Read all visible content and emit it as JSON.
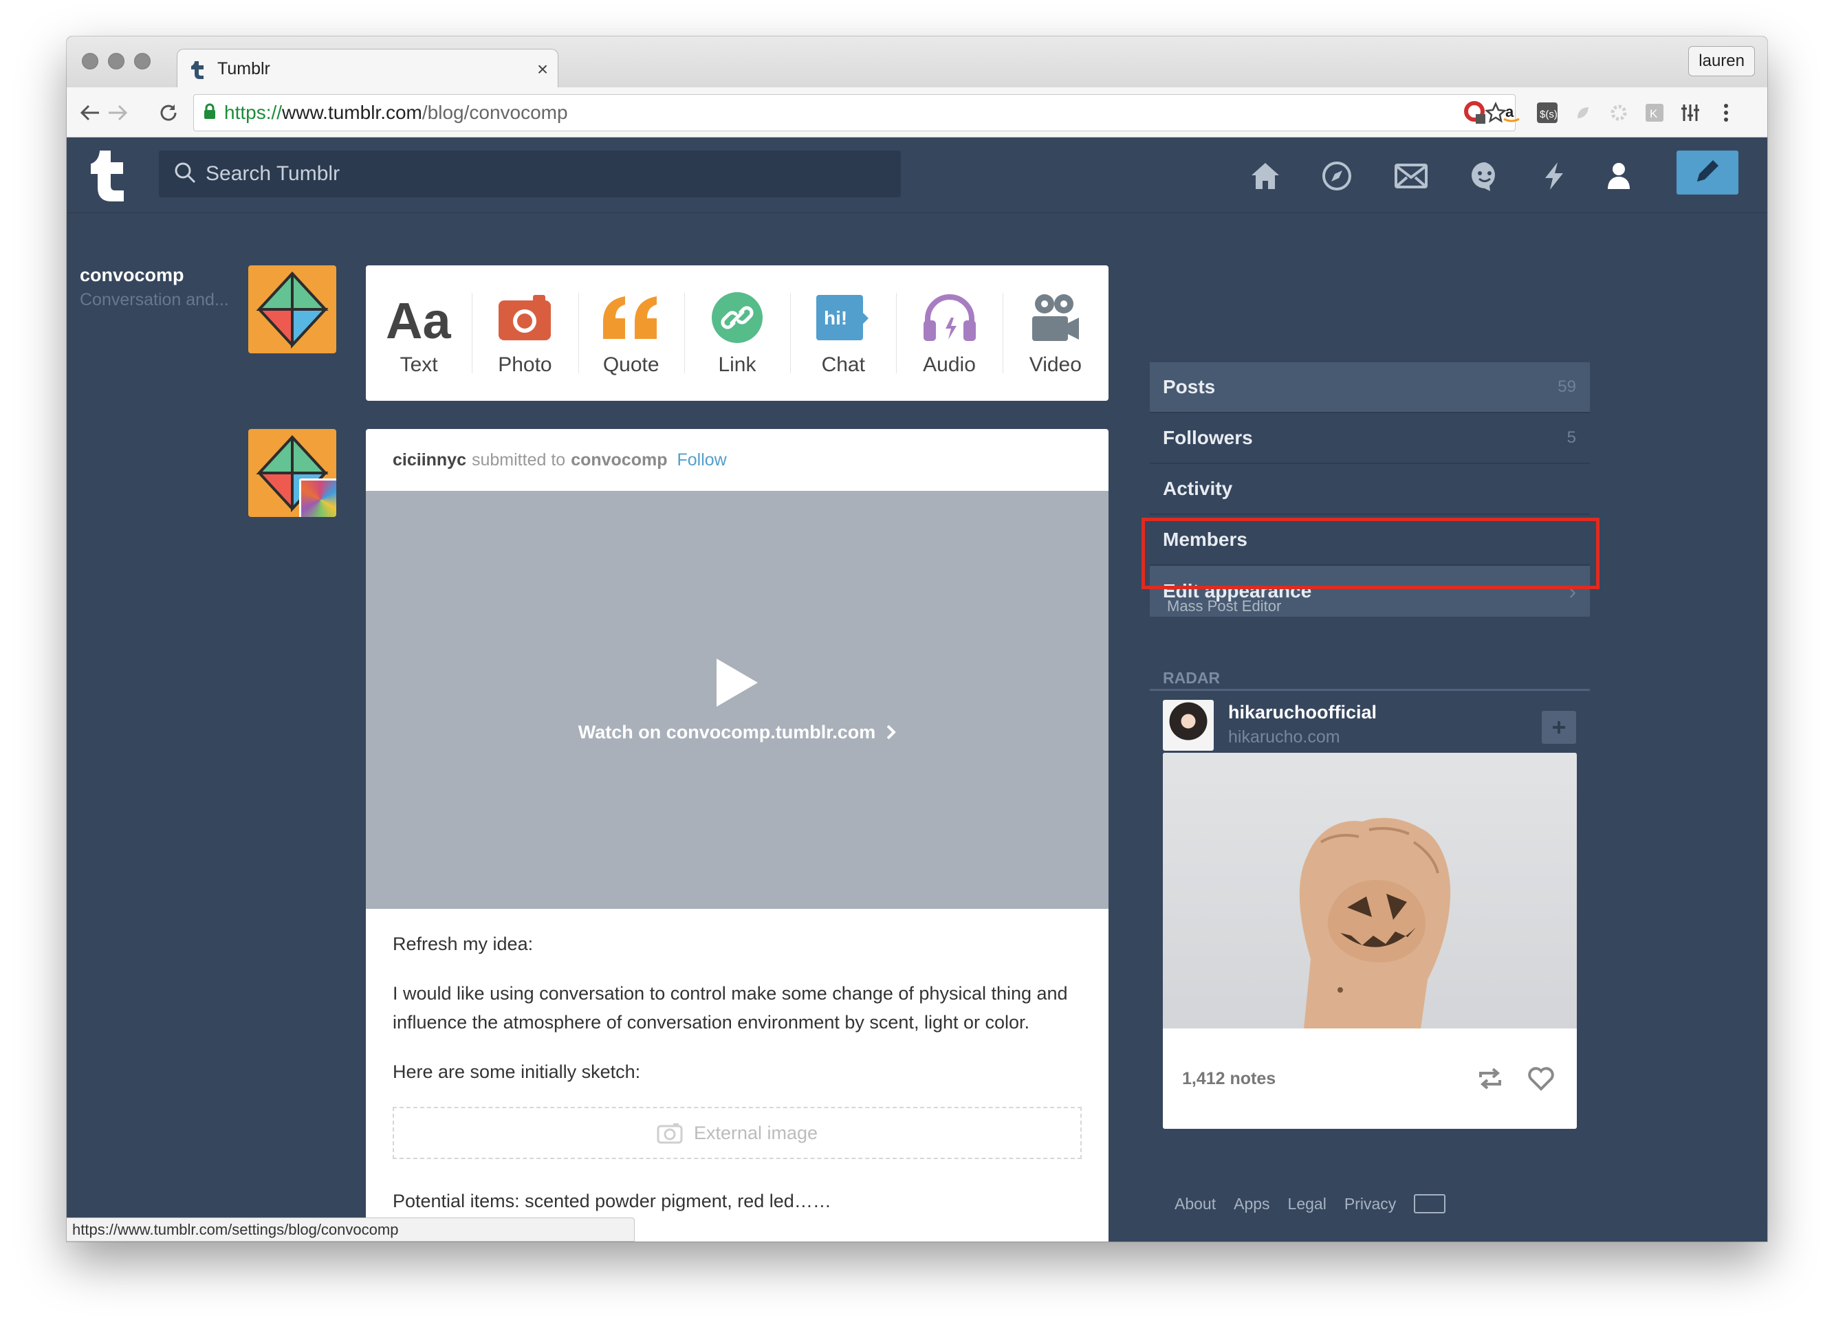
{
  "browser": {
    "tab_title": "Tumblr",
    "tab_close": "×",
    "url_scheme": "https://",
    "url_host": "www.tumblr.com",
    "url_path": "/blog/convocomp",
    "profile_name": "lauren",
    "status_url": "https://www.tumblr.com/settings/blog/convocomp"
  },
  "header": {
    "search_placeholder": "Search Tumblr",
    "nav_icons": [
      "home-icon",
      "explore-icon",
      "inbox-icon",
      "messaging-icon",
      "activity-icon",
      "account-icon"
    ],
    "compose_icon": "pencil-icon",
    "accent": "#529ecc"
  },
  "post_types": [
    {
      "label": "Text",
      "icon": "text-icon",
      "color": "#444444"
    },
    {
      "label": "Photo",
      "icon": "camera-icon",
      "color": "#d95e40"
    },
    {
      "label": "Quote",
      "icon": "quote-icon",
      "color": "#f2992e"
    },
    {
      "label": "Link",
      "icon": "link-icon",
      "color": "#56bc8a"
    },
    {
      "label": "Chat",
      "icon": "chat-icon",
      "color": "#529ecc"
    },
    {
      "label": "Audio",
      "icon": "headphones-icon",
      "color": "#a77dc2"
    },
    {
      "label": "Video",
      "icon": "video-camera-icon",
      "color": "#748089"
    }
  ],
  "post": {
    "author": "ciciinnyc",
    "submitted_to": "submitted to",
    "blog": "convocomp",
    "follow": "Follow",
    "watch_label": "Watch on convocomp.tumblr.com",
    "paragraphs": [
      "Refresh my idea:",
      "I would like using conversation to control make some change of physical thing and influence the atmosphere of conversation environment by scent, light or color.",
      "Here are some initially sketch:"
    ],
    "external_image": "External image",
    "last_line": "Potential items: scented powder pigment, red led……"
  },
  "sidebar": {
    "blog_name": "convocomp",
    "blog_desc": "Conversation and...",
    "items": [
      {
        "label": "Posts",
        "count": "59"
      },
      {
        "label": "Followers",
        "count": "5"
      },
      {
        "label": "Activity",
        "count": ""
      },
      {
        "label": "Members",
        "count": ""
      },
      {
        "label": "Edit appearance",
        "count": "›"
      }
    ],
    "mass_post_editor": "Mass Post Editor",
    "radar_title": "RADAR",
    "radar_user": "hikaruchoofficial",
    "radar_url": "hikarucho.com",
    "radar_notes": "1,412 notes",
    "highlight_color": "#e02b20"
  },
  "footer": {
    "links": [
      "About",
      "Apps",
      "Legal",
      "Privacy"
    ]
  }
}
